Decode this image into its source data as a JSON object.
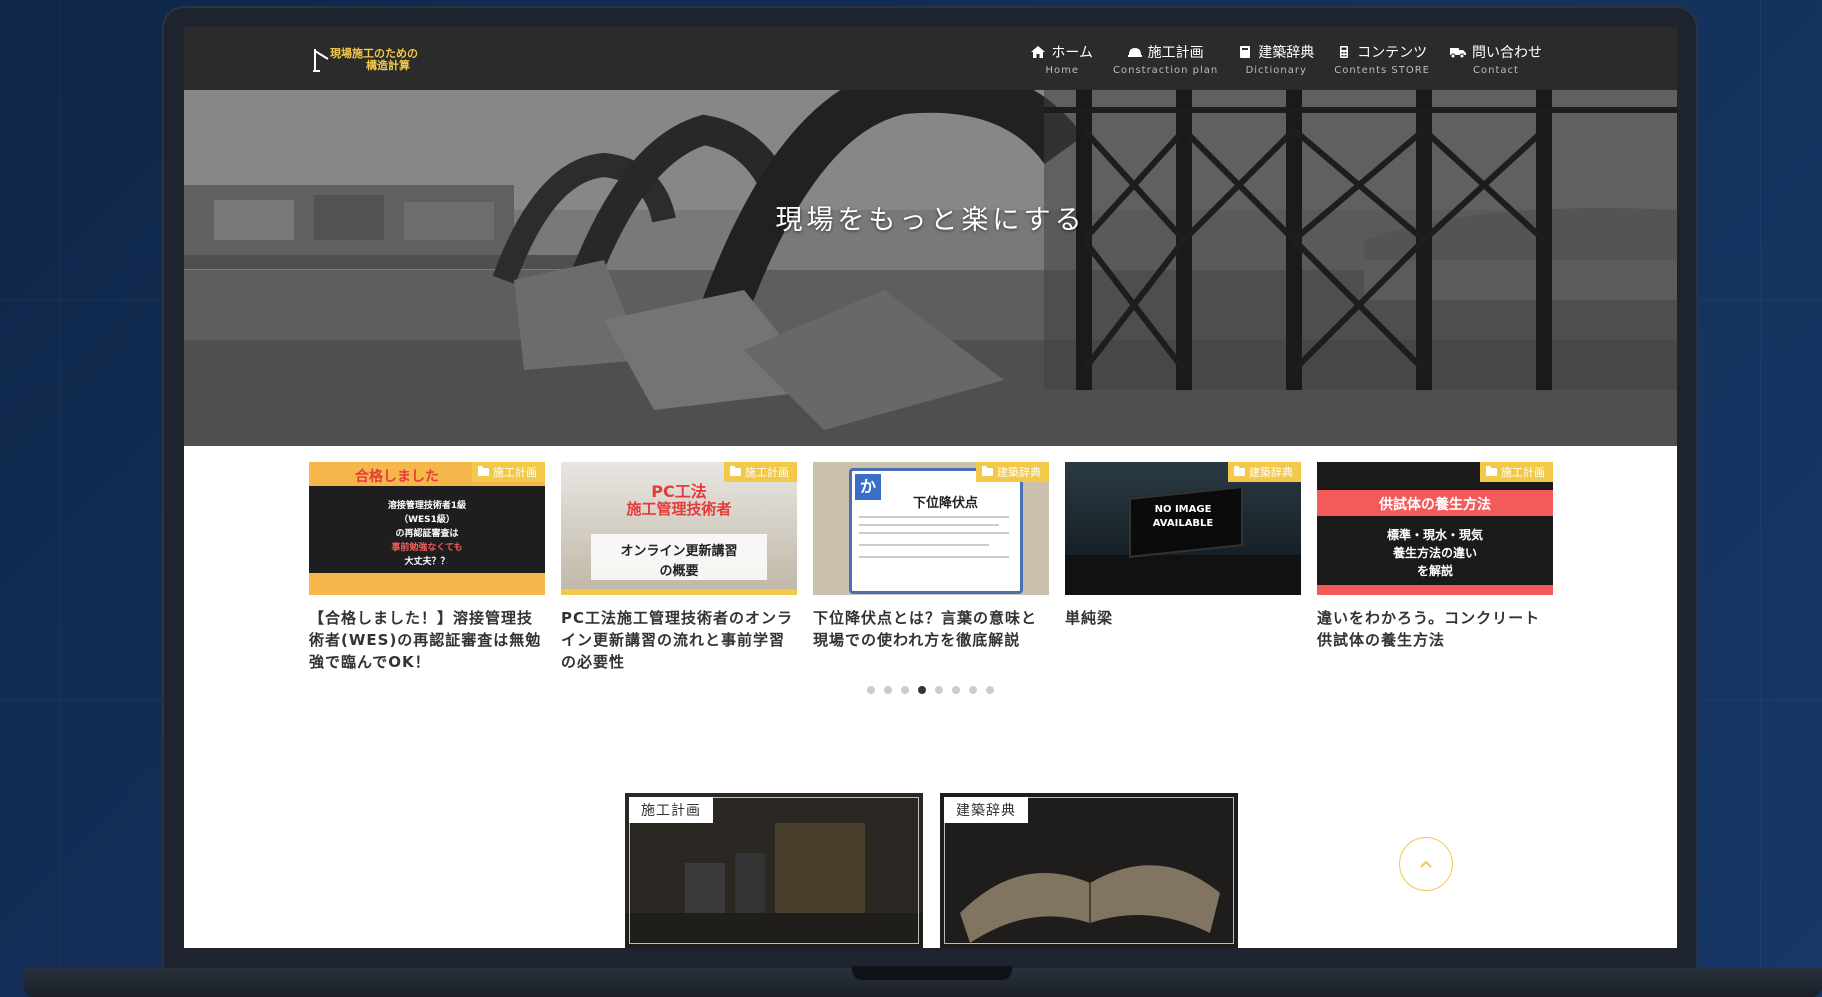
{
  "header": {
    "logo_text_line1": "現場施工のための",
    "logo_text_line2": "構造計算",
    "nav": [
      {
        "label": "ホーム",
        "sub": "Home",
        "icon": "home-icon"
      },
      {
        "label": "施工計画",
        "sub": "Constraction plan",
        "icon": "hardhat-icon"
      },
      {
        "label": "建築辞典",
        "sub": "Dictionary",
        "icon": "book-icon"
      },
      {
        "label": "コンテンツ",
        "sub": "Contents STORE",
        "icon": "calculator-icon"
      },
      {
        "label": "問い合わせ",
        "sub": "Contact",
        "icon": "truck-icon"
      }
    ]
  },
  "hero": {
    "title": "現場をもっと楽にする"
  },
  "carousel": {
    "cards": [
      {
        "category": "施工計画",
        "title": "【合格しました！】溶接管理技術者(WES)の再認証審査は無勉強で臨んでOK！",
        "thumb_lines": [
          "合格しました",
          "溶接管理技術者1級",
          "（WES1級）",
          "の再認証審査は",
          "事前勉強なくても",
          "大丈夫？？"
        ]
      },
      {
        "category": "施工計画",
        "title": "PC工法施工管理技術者のオンライン更新講習の流れと事前学習の必要性",
        "thumb_lines": [
          "PC工法",
          "施工管理技術者",
          "オンライン更新講習",
          "の概要"
        ]
      },
      {
        "category": "建築辞典",
        "title": "下位降伏点とは？言葉の意味と現場での使われ方を徹底解説",
        "thumb_lines": [
          "か",
          "下位降伏点"
        ]
      },
      {
        "category": "建築辞典",
        "title": "単純梁",
        "thumb_lines": [
          "NO IMAGE",
          "AVAILABLE"
        ]
      },
      {
        "category": "施工計画",
        "title": "違いをわかろう。コンクリート供試体の養生方法",
        "thumb_lines": [
          "供試体の養生方法",
          "標準・現水・現気",
          "養生方法の違い",
          "を解説"
        ]
      }
    ],
    "dots_total": 8,
    "dots_active_index": 3
  },
  "tiles": [
    {
      "label": "施工計画"
    },
    {
      "label": "建築辞典"
    }
  ],
  "colors": {
    "accent": "#f3c94a",
    "header_bg": "#2b2b2b",
    "red": "#f35b5b"
  }
}
